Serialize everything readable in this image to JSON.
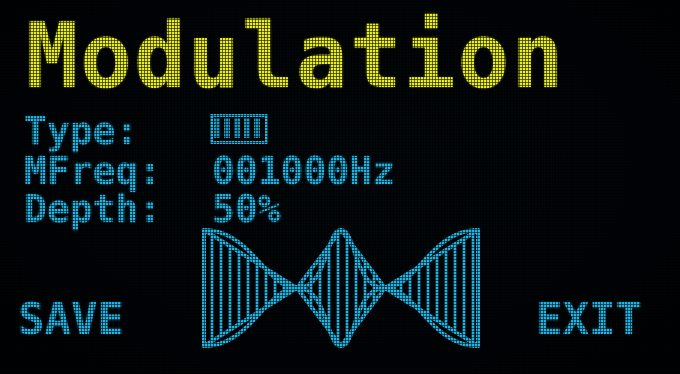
{
  "screen": {
    "title": "Modulation",
    "colors": {
      "title": "#e8ee1c",
      "text": "#1fb6e6",
      "background": "#010406"
    }
  },
  "params": {
    "type_label": "Type:",
    "type_value": "AM",
    "freq_label": "MFreq:",
    "freq_value": "001000Hz",
    "depth_label": "Depth:",
    "depth_value": "50%"
  },
  "softkeys": {
    "left": "SAVE",
    "right": "EXIT"
  },
  "waveform": {
    "icon": "am-modulation-envelope-icon"
  }
}
